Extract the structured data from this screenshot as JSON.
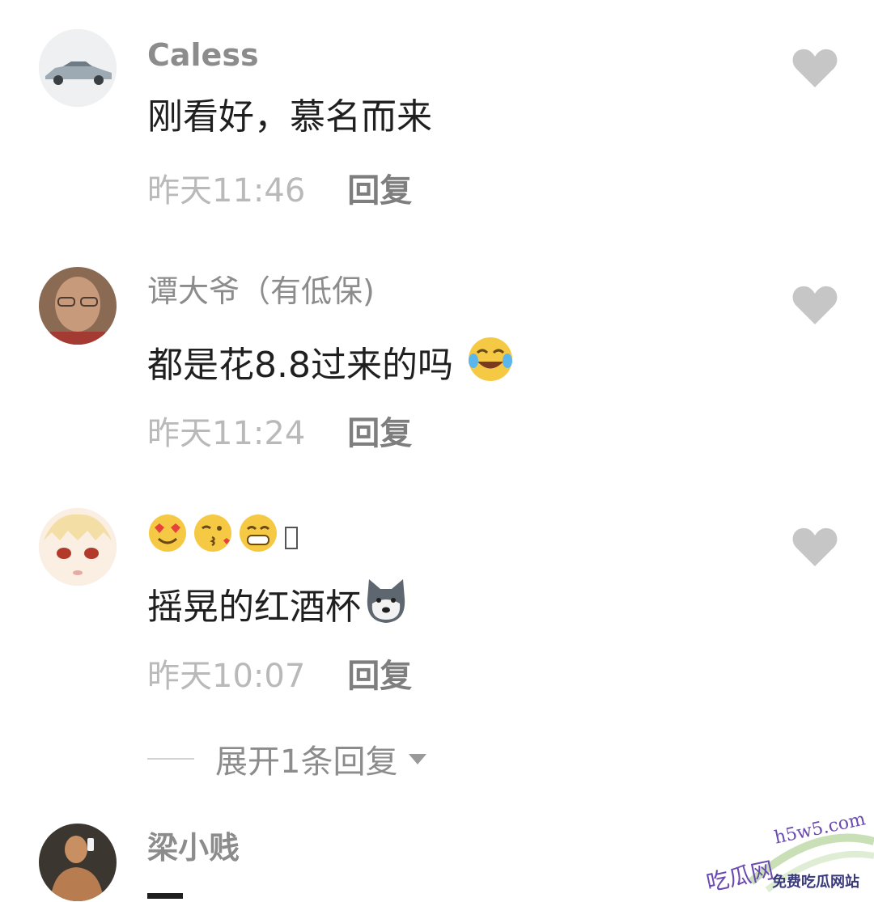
{
  "colors": {
    "background": "#ffffff",
    "username": "#8c8c8c",
    "content": "#1f1f1f",
    "time": "#b9b9b9",
    "reply": "#7e7e7e",
    "like": "#c6c6c6"
  },
  "comments": [
    {
      "username": "Caless",
      "content": "刚看好，慕名而来",
      "time": "昨天11:46",
      "reply": "回复",
      "emojis": []
    },
    {
      "username": "谭大爷（有低保)",
      "content": "都是花8.8过来的吗",
      "time": "昨天11:24",
      "reply": "回复",
      "emojis": [
        "tears-of-joy-emoji"
      ]
    },
    {
      "username": "",
      "content": "摇晃的红酒杯",
      "time": "昨天10:07",
      "reply": "回复",
      "username_emojis": [
        "heart-eyes-emoji",
        "kiss-emoji",
        "grin-emoji"
      ],
      "emojis": [
        "husky-dog-emoji"
      ]
    },
    {
      "username": "梁小贱",
      "content": "",
      "time": "",
      "reply": ""
    }
  ],
  "expand_replies": "展开1条回复",
  "watermark": {
    "domain": "h5w5.com",
    "title": "吃瓜网",
    "slogan": "免费吃瓜网站"
  }
}
